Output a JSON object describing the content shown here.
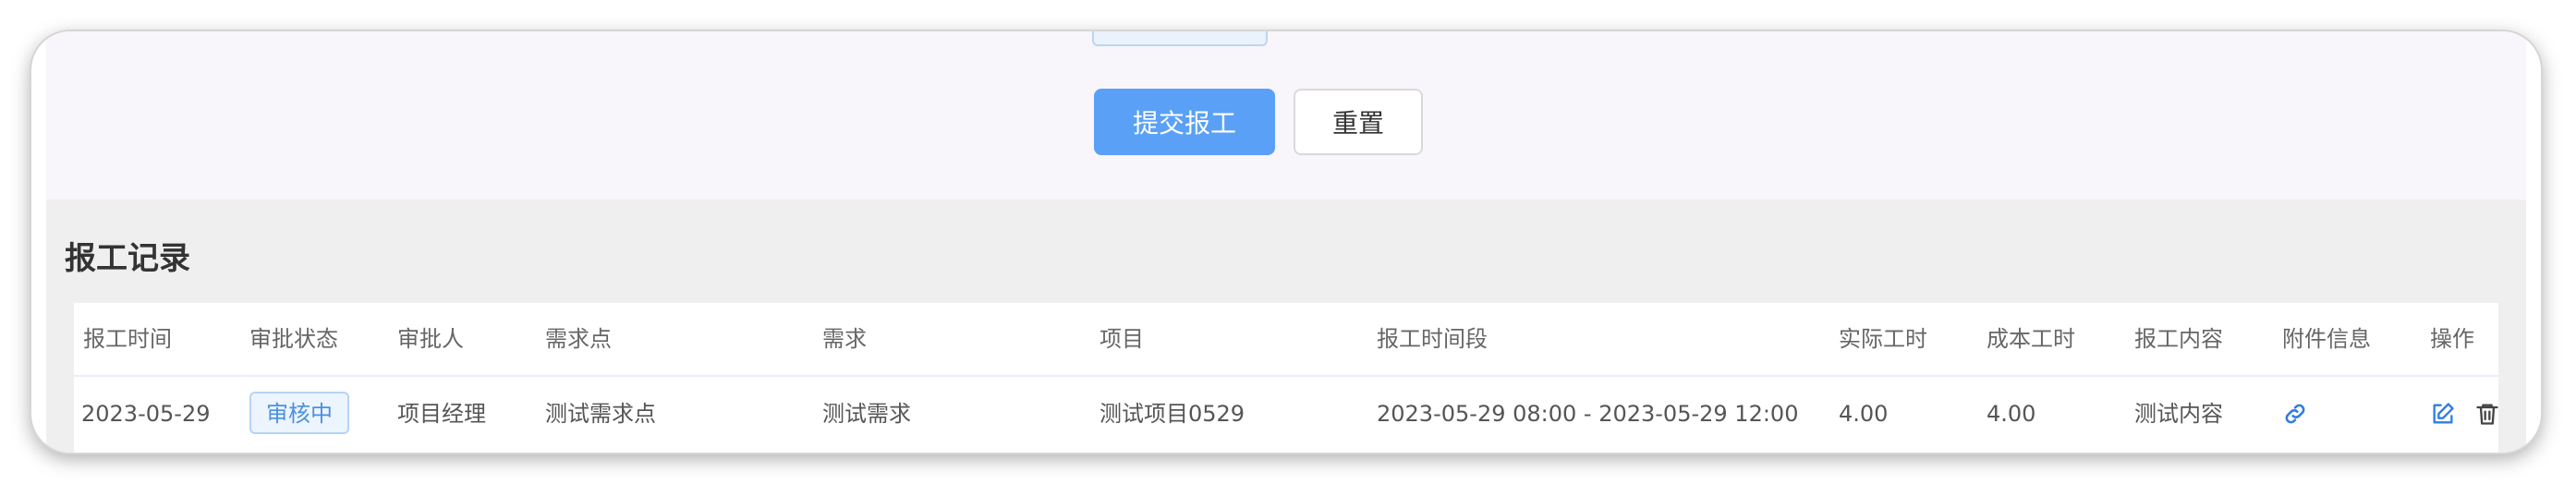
{
  "form": {
    "submit_label": "提交报工",
    "reset_label": "重置"
  },
  "records": {
    "title": "报工记录",
    "columns": [
      "报工时间",
      "审批状态",
      "审批人",
      "需求点",
      "需求",
      "项目",
      "报工时间段",
      "实际工时",
      "成本工时",
      "报工内容",
      "附件信息",
      "操作"
    ],
    "rows": [
      {
        "date": "2023-05-29",
        "status": "审核中",
        "approver": "项目经理",
        "requirement_point": "测试需求点",
        "requirement": "测试需求",
        "project": "测试项目0529",
        "period": "2023-05-29 08:00 - 2023-05-29 12:00",
        "actual_hours": "4.00",
        "cost_hours": "4.00",
        "content": "测试内容"
      }
    ]
  },
  "icons": {
    "attachment": "link-icon",
    "edit": "edit-icon",
    "delete": "trash-icon"
  },
  "colors": {
    "primary": "#5aa0f7",
    "status_text": "#4a90e2",
    "status_bg": "#ecf4fd",
    "link_icon": "#2f7de1"
  }
}
